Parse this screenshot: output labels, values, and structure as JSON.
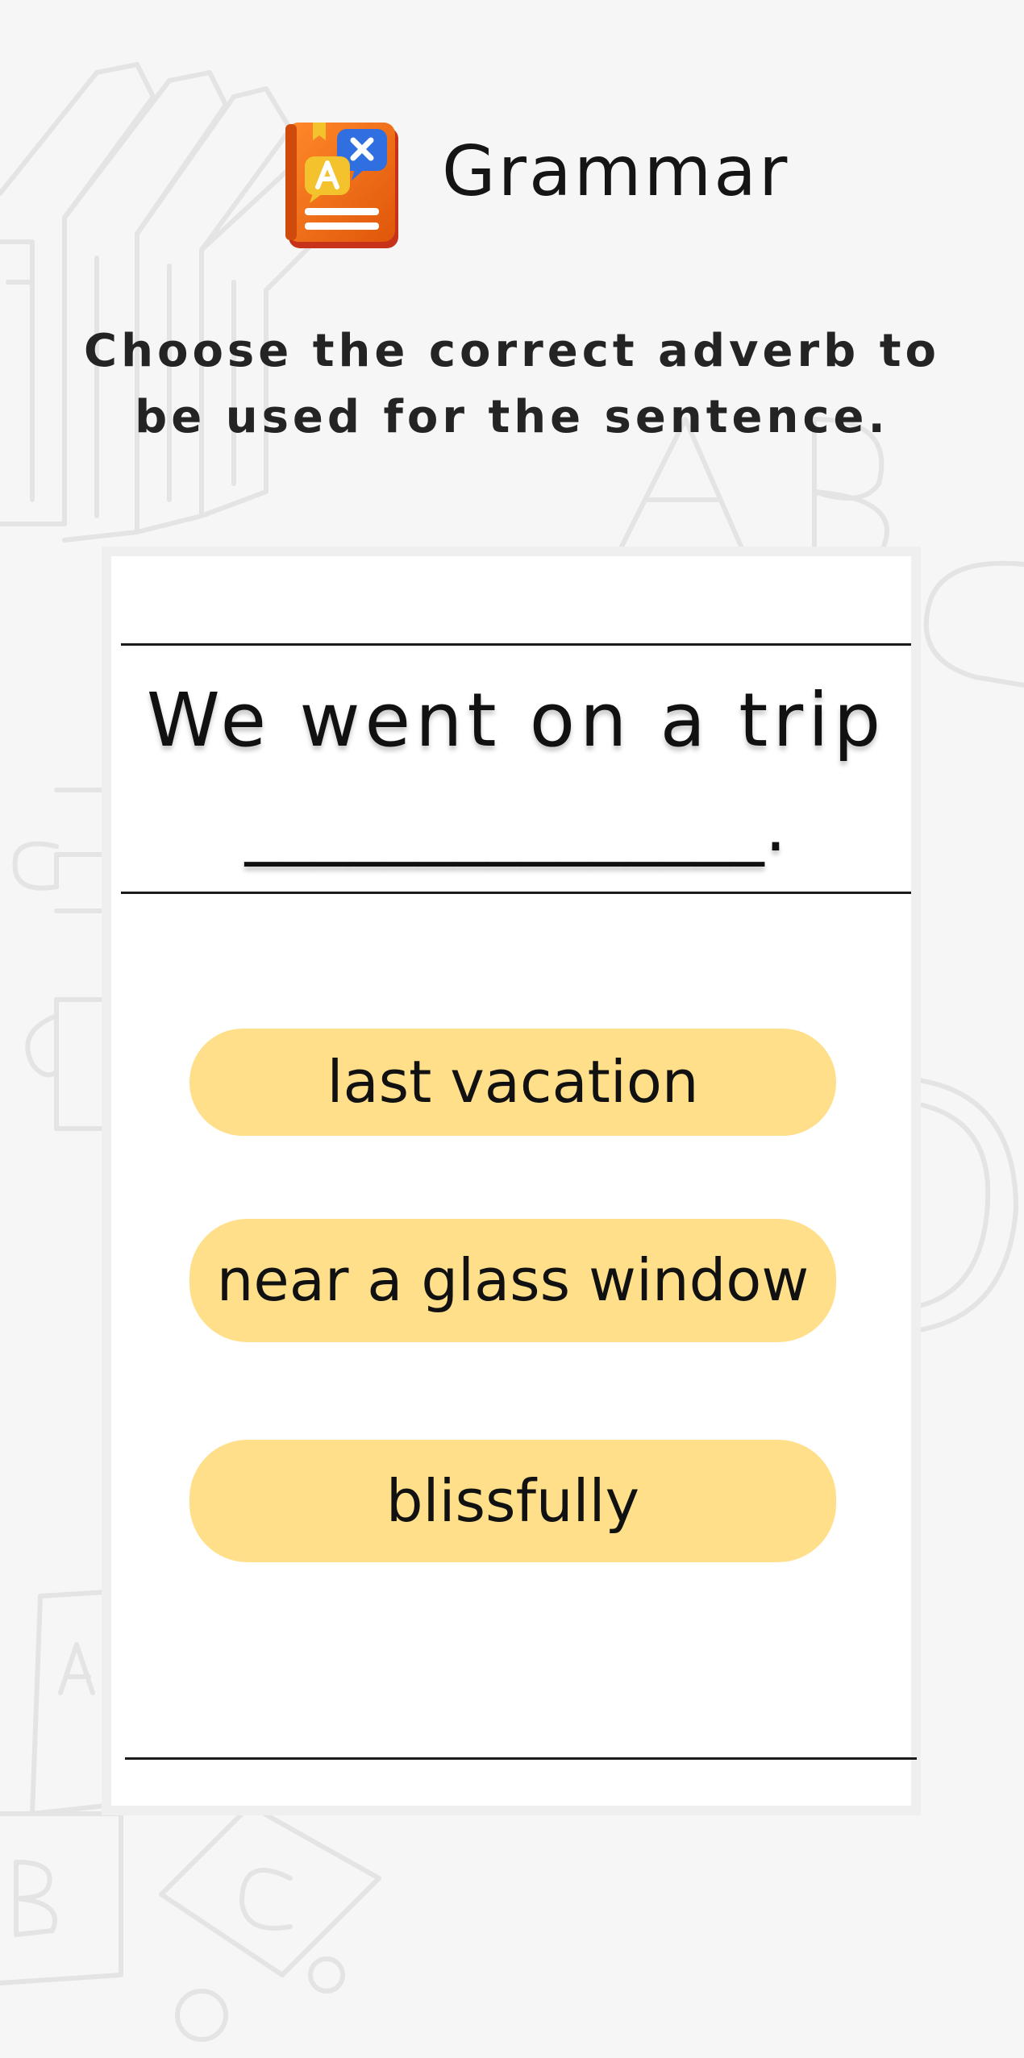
{
  "header": {
    "title": "Grammar",
    "icon": "translate-book-icon"
  },
  "instruction": {
    "line1": "Choose the correct adverb to",
    "line2": "be used for the sentence."
  },
  "question": {
    "text": "We went on a trip",
    "blank": "_______________."
  },
  "options": [
    {
      "label": "last vacation"
    },
    {
      "label": "near a glass window"
    },
    {
      "label": "blissfully"
    }
  ],
  "colors": {
    "background": "#f6f6f6",
    "card": "#ffffff",
    "option_fill": "#ffdf8a",
    "icon_orange": "#f06b13",
    "icon_blue": "#2f6fe0",
    "icon_yellow": "#f4c22c"
  }
}
